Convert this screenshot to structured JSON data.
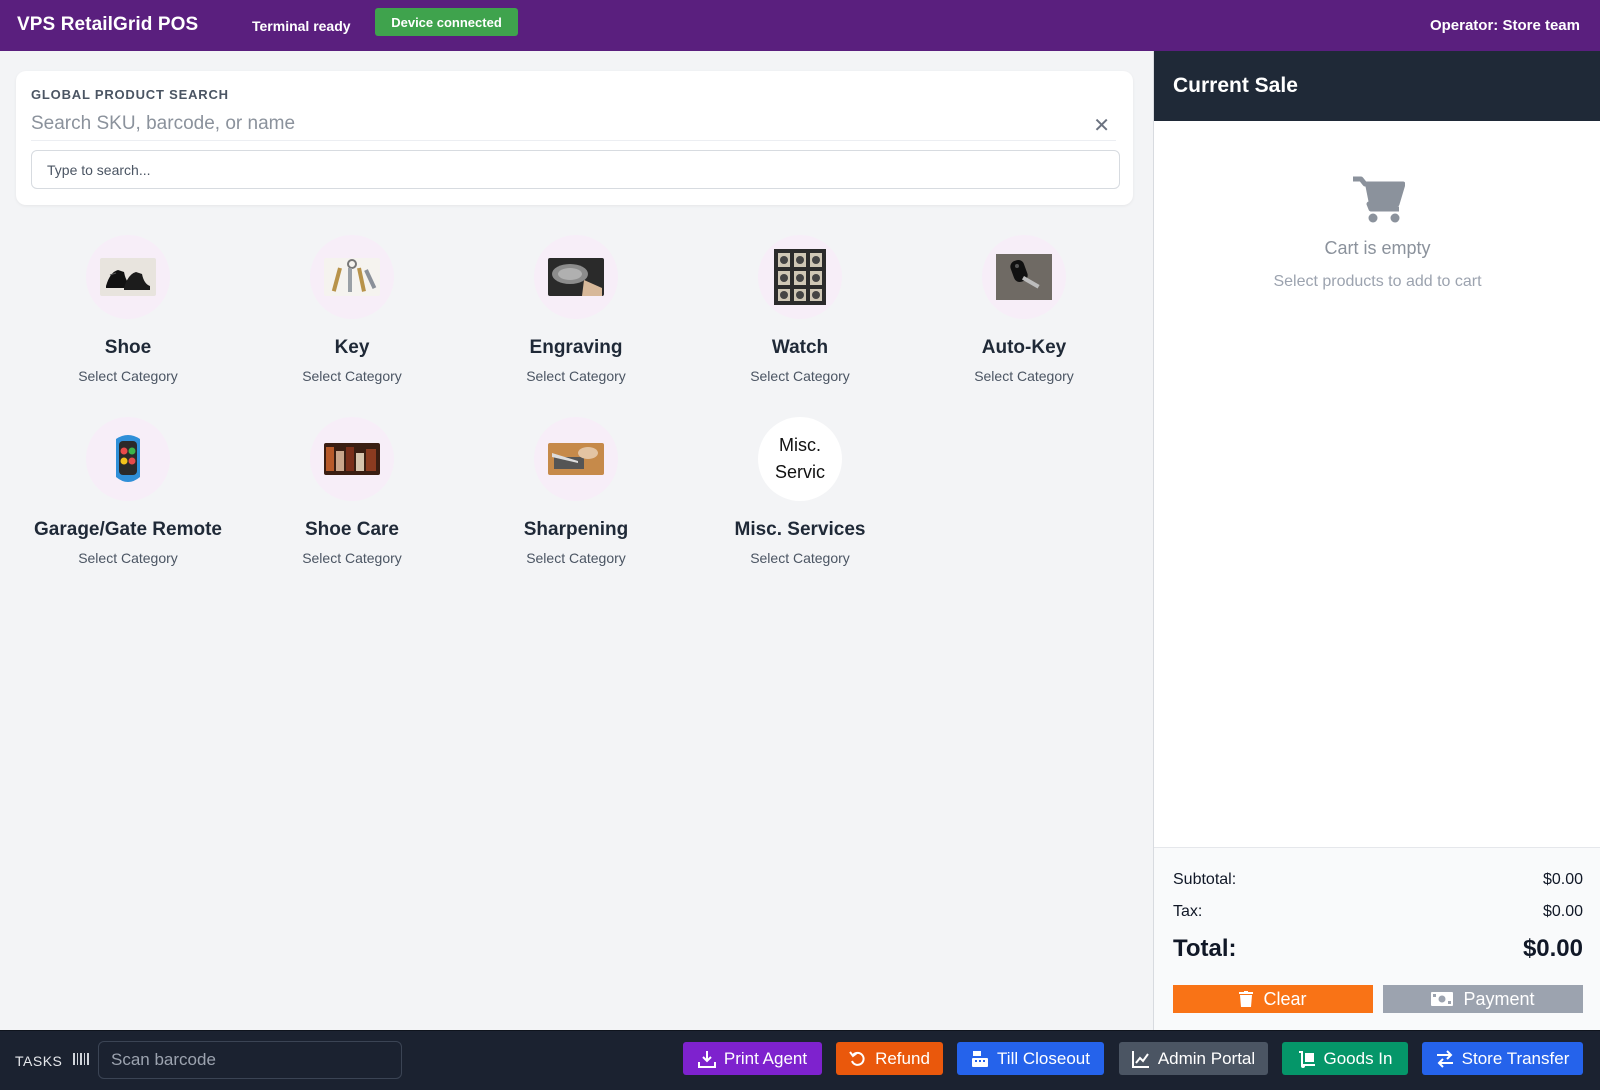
{
  "header": {
    "app_title": "VPS RetailGrid POS",
    "terminal_status": "Terminal ready",
    "device_status": "Device connected",
    "operator": "Operator: Store team"
  },
  "search": {
    "label": "GLOBAL PRODUCT SEARCH",
    "placeholder": "Search SKU, barcode, or name",
    "secondary_placeholder": "Type to search..."
  },
  "categories": [
    {
      "name": "Shoe",
      "sub": "Select Category",
      "icon": "shoe-icon"
    },
    {
      "name": "Key",
      "sub": "Select Category",
      "icon": "key-icon"
    },
    {
      "name": "Engraving",
      "sub": "Select Category",
      "icon": "engraving-icon"
    },
    {
      "name": "Watch",
      "sub": "Select Category",
      "icon": "watch-icon"
    },
    {
      "name": "Auto-Key",
      "sub": "Select Category",
      "icon": "car-key-icon"
    },
    {
      "name": "Garage/Gate Remote",
      "sub": "Select Category",
      "icon": "remote-icon"
    },
    {
      "name": "Shoe Care",
      "sub": "Select Category",
      "icon": "shoe-care-icon"
    },
    {
      "name": "Sharpening",
      "sub": "Select Category",
      "icon": "sharpening-icon"
    },
    {
      "name": "Misc. Services",
      "sub": "Select Category",
      "icon": "misc-services-icon",
      "thumb_text": "Misc. Servic"
    }
  ],
  "cart": {
    "title": "Current Sale",
    "empty_title": "Cart is empty",
    "empty_sub": "Select products to add to cart",
    "subtotal_label": "Subtotal:",
    "subtotal_value": "$0.00",
    "tax_label": "Tax:",
    "tax_value": "$0.00",
    "total_label": "Total:",
    "total_value": "$0.00",
    "clear_label": "Clear",
    "payment_label": "Payment"
  },
  "bottombar": {
    "tasks_label": "TASKS",
    "scan_placeholder": "Scan barcode",
    "buttons": [
      {
        "label": "Print Agent",
        "color": "#7e22ce",
        "icon": "download-icon"
      },
      {
        "label": "Refund",
        "color": "#ea580c",
        "icon": "undo-icon"
      },
      {
        "label": "Till Closeout",
        "color": "#2563eb",
        "icon": "cash-register-icon"
      },
      {
        "label": "Admin Portal",
        "color": "#4b5563",
        "icon": "chart-line-icon"
      },
      {
        "label": "Goods In",
        "color": "#059669",
        "icon": "dolly-icon"
      },
      {
        "label": "Store Transfer",
        "color": "#2563eb",
        "icon": "transfer-icon"
      }
    ]
  },
  "colors": {
    "header_bg": "#5a1f7e",
    "device_badge": "#3fa34d",
    "cart_header": "#1f2937",
    "clear_button": "#f97316",
    "payment_button": "#9ca3af"
  }
}
